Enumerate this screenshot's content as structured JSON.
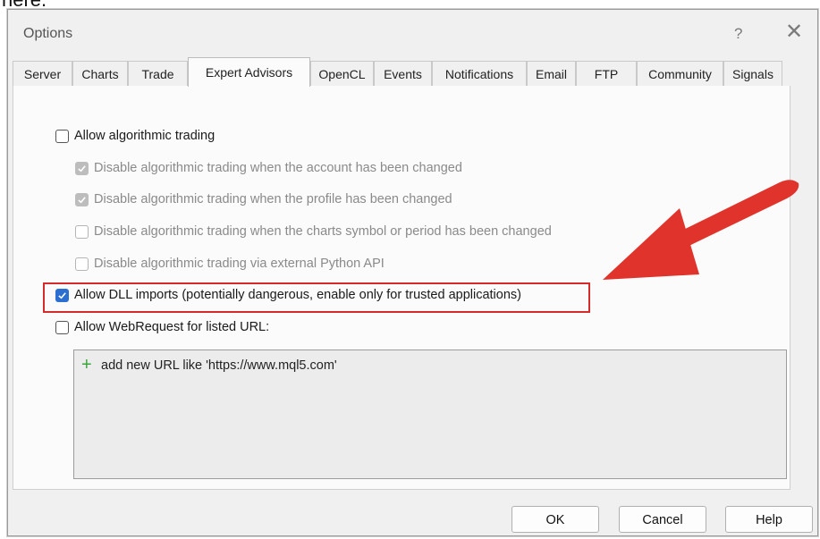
{
  "cropped_text": "here.",
  "window": {
    "title": "Options",
    "help": "?",
    "close": "✕"
  },
  "tabs": [
    {
      "label": "Server",
      "active": false
    },
    {
      "label": "Charts",
      "active": false
    },
    {
      "label": "Trade",
      "active": false
    },
    {
      "label": "Expert Advisors",
      "active": true
    },
    {
      "label": "OpenCL",
      "active": false
    },
    {
      "label": "Events",
      "active": false
    },
    {
      "label": "Notifications",
      "active": false
    },
    {
      "label": "Email",
      "active": false
    },
    {
      "label": "FTP",
      "active": false
    },
    {
      "label": "Community",
      "active": false
    },
    {
      "label": "Signals",
      "active": false
    }
  ],
  "options": [
    {
      "label": "Allow algorithmic trading",
      "checked": false,
      "disabled": false
    },
    {
      "label": "Disable algorithmic trading when the account has been changed",
      "checked": true,
      "disabled": true
    },
    {
      "label": "Disable algorithmic trading when the profile has been changed",
      "checked": true,
      "disabled": true
    },
    {
      "label": "Disable algorithmic trading when the charts symbol or period has been changed",
      "checked": false,
      "disabled": true
    },
    {
      "label": "Disable algorithmic trading via external Python API",
      "checked": false,
      "disabled": true
    },
    {
      "label": "Allow DLL imports (potentially dangerous, enable only for trusted applications)",
      "checked": true,
      "disabled": false
    },
    {
      "label": "Allow WebRequest for listed URL:",
      "checked": false,
      "disabled": false
    }
  ],
  "url_list": {
    "add_text": "add new URL like 'https://www.mql5.com'"
  },
  "buttons": {
    "ok": "OK",
    "cancel": "Cancel",
    "help": "Help"
  },
  "colors": {
    "highlight": "#d62b2b",
    "arrow": "#e0332b",
    "check_blue": "#2b6fd1",
    "plus_green": "#3aa53a"
  }
}
